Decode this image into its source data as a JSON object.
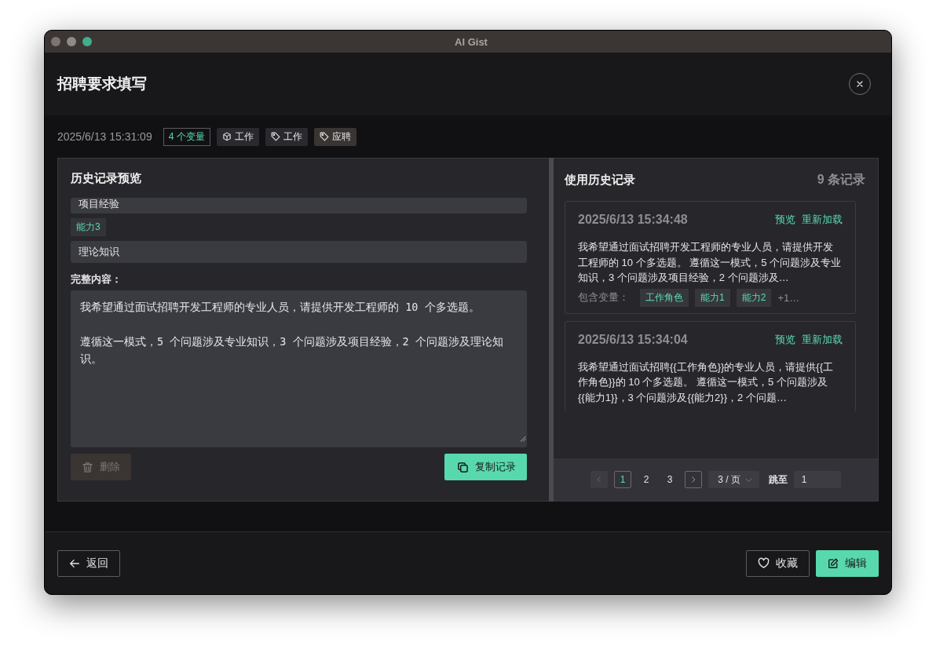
{
  "window": {
    "title": "AI Gist"
  },
  "dialog": {
    "title": "招聘要求填写"
  },
  "meta": {
    "timestamp": "2025/6/13 15:31:09",
    "variable_count": "4 个变量",
    "tags": [
      {
        "kind": "category",
        "label": "工作"
      },
      {
        "kind": "tag",
        "label": "工作"
      },
      {
        "kind": "tag",
        "label": "应聘"
      }
    ]
  },
  "preview": {
    "title": "历史记录预览",
    "fields": [
      {
        "kind": "value",
        "text": "项目经验"
      },
      {
        "kind": "label",
        "text": "能力3"
      },
      {
        "kind": "value",
        "text": "理论知识"
      }
    ],
    "content_label": "完整内容：",
    "content": [
      "我希望通过面试招聘开发工程师的专业人员，请提供开发工程师的 10 个多选题。",
      "遵循这一模式，5 个问题涉及专业知识，3 个问题涉及项目经验，2 个问题涉及理论知识。"
    ],
    "delete_button": {
      "label": "删除",
      "disabled": true
    },
    "copy_button": {
      "label": "复制记录"
    }
  },
  "history": {
    "title": "使用历史记录",
    "count": "9 条记录",
    "records": [
      {
        "timestamp": "2025/6/13 15:34:48",
        "actions": [
          "预览",
          "重新加载"
        ],
        "text": "我希望通过面试招聘开发工程师的专业人员，请提供开发工程师的 10 个多选题。 遵循这一模式，5 个问题涉及专业知识，3 个问题涉及项目经验，2 个问题涉及…",
        "variables_label": "包含变量：",
        "variables": [
          "工作角色",
          "能力1",
          "能力2"
        ],
        "more": "+1…"
      },
      {
        "timestamp": "2025/6/13 15:34:04",
        "actions": [
          "预览",
          "重新加载"
        ],
        "text": "我希望通过面试招聘{{工作角色}}的专业人员，请提供{{工作角色}}的 10 个多选题。 遵循这一模式，5 个问题涉及{{能力1}}，3 个问题涉及{{能力2}}，2 个问题…"
      }
    ],
    "pagination": {
      "prev_disabled": true,
      "next_disabled": false,
      "pages": [
        {
          "label": "1",
          "selected": true
        },
        {
          "label": "2",
          "selected": false
        },
        {
          "label": "3",
          "selected": false
        }
      ],
      "per_page": "3 / 页",
      "jump_label": "跳至",
      "jump_value": "1"
    }
  },
  "footer": {
    "back_label": "返回",
    "favorite_label": "收藏",
    "edit_label": "编辑"
  }
}
